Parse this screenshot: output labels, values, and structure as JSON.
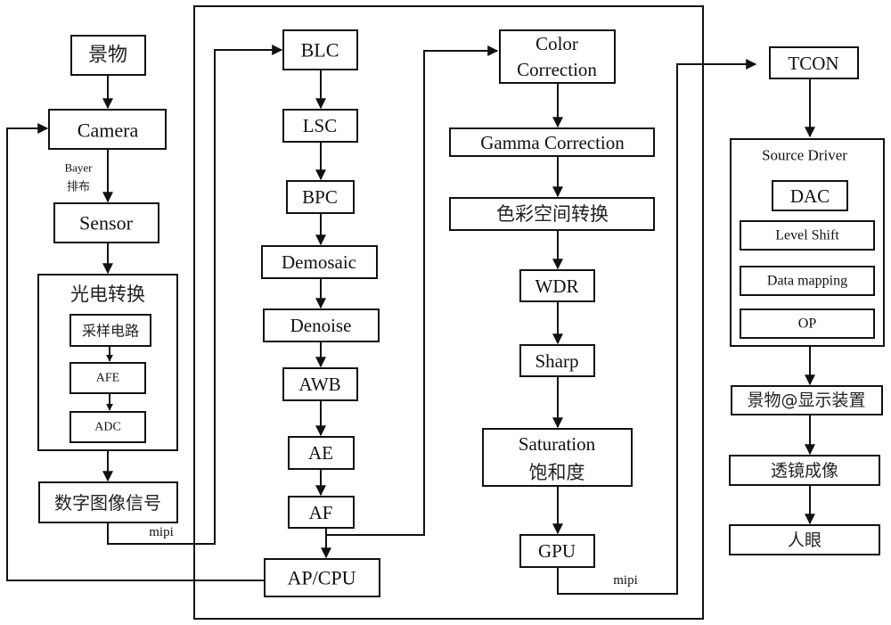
{
  "colors": {
    "stroke": "#111111",
    "background": "#ffffff"
  },
  "capture": {
    "scene": "景物",
    "camera": "Camera",
    "bayer_label_1": "Bayer",
    "bayer_label_2": "排布",
    "sensor": "Sensor",
    "photoelectric": {
      "title": "光电转换",
      "steps": [
        "采样电路",
        "AFE",
        "ADC"
      ]
    },
    "digital_signal": "数字图像信号",
    "mipi_label": "mipi"
  },
  "isp": {
    "column1": [
      "BLC",
      "LSC",
      "BPC",
      "Demosaic",
      "Denoise",
      "AWB",
      "AE",
      "AF"
    ],
    "ap_cpu": "AP/CPU",
    "column2": {
      "color_correction_1": "Color",
      "color_correction_2": "Correction",
      "gamma": "Gamma Correction",
      "color_space": "色彩空间转换",
      "wdr": "WDR",
      "sharp": "Sharp",
      "saturation_1": "Saturation",
      "saturation_2": "饱和度",
      "gpu": "GPU"
    },
    "mipi_label": "mipi"
  },
  "display": {
    "tcon": "TCON",
    "source_driver": {
      "title": "Source Driver",
      "items": [
        "DAC",
        "Level Shift",
        "Data mapping",
        "OP"
      ]
    },
    "scene_display": "景物@显示装置",
    "lens": "透镜成像",
    "eye": "人眼"
  }
}
